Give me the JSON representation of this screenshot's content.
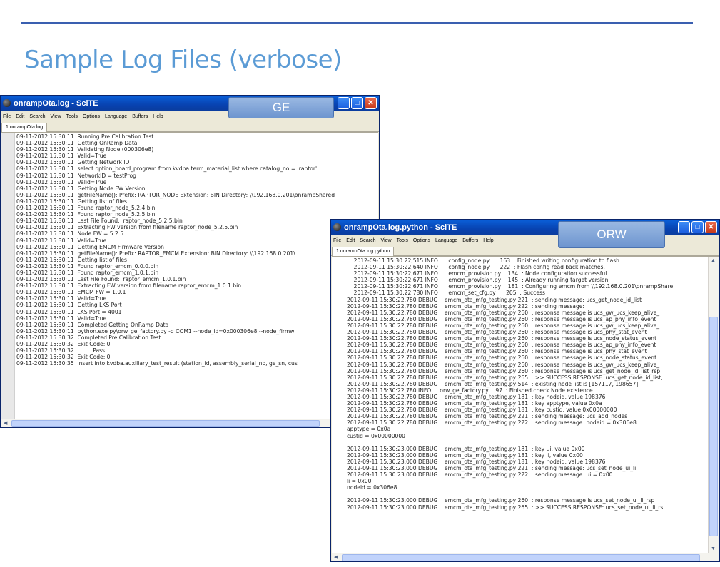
{
  "slide": {
    "title": "Sample Log Files (verbose)"
  },
  "colors": {
    "rule": "#3a5fb0",
    "title": "#5b9bd5",
    "titlebar": "#0842b0",
    "label": "#7aa0d8"
  },
  "menu_items": [
    "File",
    "Edit",
    "Search",
    "View",
    "Tools",
    "Options",
    "Language",
    "Buffers",
    "Help"
  ],
  "ge_window": {
    "title": "onrampOta.log - SciTE",
    "tab": "1 onrampOta.log",
    "label": "GE",
    "lines": [
      "09-11-2012 15:30:11  Running Pre Calibration Test",
      "09-11-2012 15:30:11  Getting OnRamp Data",
      "09-11-2012 15:30:11  Validating Node (000306e8)",
      "09-11-2012 15:30:11  Valid=True",
      "09-11-2012 15:30:11  Getting Network ID",
      "09-11-2012 15:30:11  select option_board_program from kvdba.term_material_list where catalog_no = 'raptor'",
      "09-11-2012 15:30:11  NetworkID = testProg",
      "09-11-2012 15:30:11  Valid=True",
      "09-11-2012 15:30:11  Getting Node FW Version",
      "09-11-2012 15:30:11  getFileName(): Prefix: RAPTOR_NODE Extension: BIN Directory: \\\\192.168.0.201\\onrampShared",
      "09-11-2012 15:30:11  Getting list of files",
      "09-11-2012 15:30:11  Found raptor_node_5.2.4.bin",
      "09-11-2012 15:30:11  Found raptor_node_5.2.5.bin",
      "09-11-2012 15:30:11  Last File Found:  raptor_node_5.2.5.bin",
      "09-11-2012 15:30:11  Extracting FW version from filename raptor_node_5.2.5.bin",
      "09-11-2012 15:30:11  Node FW = 5.2.5",
      "09-11-2012 15:30:11  Valid=True",
      "09-11-2012 15:30:11  Getting EMCM Firmware Version",
      "09-11-2012 15:30:11  getFileName(): Prefix: RAPTOR_EMCM Extension: BIN Directory: \\\\192.168.0.201\\",
      "09-11-2012 15:30:11  Getting list of files",
      "09-11-2012 15:30:11  Found raptor_emcm_0.0.0.bin",
      "09-11-2012 15:30:11  Found raptor_emcm_1.0.1.bin",
      "09-11-2012 15:30:11  Last File Found:  raptor_emcm_1.0.1.bin",
      "09-11-2012 15:30:11  Extracting FW version from filename raptor_emcm_1.0.1.bin",
      "09-11-2012 15:30:11  EMCM FW = 1.0.1",
      "09-11-2012 15:30:11  Valid=True",
      "09-11-2012 15:30:11  Getting LKS Port",
      "09-11-2012 15:30:11  LKS Port = 4001",
      "09-11-2012 15:30:11  Valid=True",
      "09-11-2012 15:30:11  Completed Getting OnRamp Data",
      "09-11-2012 15:30:11  python.exe py\\orw_ge_factory.py -d COM1 --node_id=0x000306e8 --node_firmw",
      "09-11-2012 15:30:32  Completed Pre Calibration Test",
      "09-11-2012 15:30:32  Exit Code: 0",
      "09-11-2012 15:30:32           Pass",
      "09-11-2012 15:30:32  Exit Code: 0",
      "09-11-2012 15:30:35  insert into kvdba.auxiliary_test_result (station_id, assembly_serial_no, ge_sn, cus"
    ]
  },
  "orw_window": {
    "title": "onrampOta.log.python - SciTE",
    "tab": "1 onrampOta.log.python",
    "label": "ORW",
    "lines": [
      "    2012-09-11 15:30:22,515 INFO      config_node.py      163  : Finished writing configuration to flash.",
      "    2012-09-11 15:30:22,640 INFO      config_node.py      222  : Flash config read back matches.",
      "    2012-09-11 15:30:22,671 INFO      emcm_provision.py    134  : Node configuration successful",
      "    2012-09-11 15:30:22,671 INFO      emcm_provision.py    145  : Already running target version",
      "    2012-09-11 15:30:22,671 INFO      emcm_provision.py    181  : Configuring emcm from \\\\192.168.0.201\\onrampShare",
      "    2012-09-11 15:30:22,780 INFO      emcm_set_cfg.py      205  : Success",
      "2012-09-11 15:30:22,780 DEBUG    emcm_ota_mfg_testing.py 221  : sending message: ucs_get_node_id_list",
      "2012-09-11 15:30:22,780 DEBUG    emcm_ota_mfg_testing.py 222  : sending message:",
      "2012-09-11 15:30:22,780 DEBUG    emcm_ota_mfg_testing.py 260  : response message is ucs_gw_ucs_keep_alive_",
      "2012-09-11 15:30:22,780 DEBUG    emcm_ota_mfg_testing.py 260  : response message is ucs_ap_phy_info_event",
      "2012-09-11 15:30:22,780 DEBUG    emcm_ota_mfg_testing.py 260  : response message is ucs_gw_ucs_keep_alive_",
      "2012-09-11 15:30:22,780 DEBUG    emcm_ota_mfg_testing.py 260  : response message is ucs_phy_stat_event",
      "2012-09-11 15:30:22,780 DEBUG    emcm_ota_mfg_testing.py 260  : response message is ucs_node_status_event",
      "2012-09-11 15:30:22,780 DEBUG    emcm_ota_mfg_testing.py 260  : response message is ucs_ap_phy_info_event",
      "2012-09-11 15:30:22,780 DEBUG    emcm_ota_mfg_testing.py 260  : response message is ucs_phy_stat_event",
      "2012-09-11 15:30:22,780 DEBUG    emcm_ota_mfg_testing.py 260  : response message is ucs_node_status_event",
      "2012-09-11 15:30:22,780 DEBUG    emcm_ota_mfg_testing.py 260  : response message is ucs_gw_ucs_keep_alive_",
      "2012-09-11 15:30:22,780 DEBUG    emcm_ota_mfg_testing.py 260  : response message is ucs_get_node_id_list_rsp",
      "2012-09-11 15:30:22,780 DEBUG    emcm_ota_mfg_testing.py 265  : >> SUCCESS RESPONSE: ucs_get_node_id_list,",
      "2012-09-11 15:30:22,780 DEBUG    emcm_ota_mfg_testing.py 514  : existing node list is [157117, 198657]",
      "2012-09-11 15:30:22,780 INFO     orw_ge_factory.py    97  : Finished check Node existence.",
      "2012-09-11 15:30:22,780 DEBUG    emcm_ota_mfg_testing.py 181  : key nodeid, value 198376",
      "2012-09-11 15:30:22,780 DEBUG    emcm_ota_mfg_testing.py 181  : key apptype, value 0x0a",
      "2012-09-11 15:30:22,780 DEBUG    emcm_ota_mfg_testing.py 181  : key custid, value 0x00000000",
      "2012-09-11 15:30:22,780 DEBUG    emcm_ota_mfg_testing.py 221  : sending message: ucs_add_nodes",
      "2012-09-11 15:30:22,780 DEBUG    emcm_ota_mfg_testing.py 222  : sending message: nodeid = 0x306e8",
      "apptype = 0x0a",
      "custid = 0x00000000",
      "",
      "2012-09-11 15:30:23,000 DEBUG    emcm_ota_mfg_testing.py 181  : key ui, value 0x00",
      "2012-09-11 15:30:23,000 DEBUG    emcm_ota_mfg_testing.py 181  : key li, value 0x00",
      "2012-09-11 15:30:23,000 DEBUG    emcm_ota_mfg_testing.py 181  : key nodeid, value 198376",
      "2012-09-11 15:30:23,000 DEBUG    emcm_ota_mfg_testing.py 221  : sending message: ucs_set_node_ui_li",
      "2012-09-11 15:30:23,000 DEBUG    emcm_ota_mfg_testing.py 222  : sending message: ui = 0x00",
      "li = 0x00",
      "nodeid = 0x306e8",
      "",
      "2012-09-11 15:30:23,000 DEBUG    emcm_ota_mfg_testing.py 260  : response message is ucs_set_node_ui_li_rsp",
      "2012-09-11 15:30:23,000 DEBUG    emcm_ota_mfg_testing.py 265  : >> SUCCESS RESPONSE: ucs_set_node_ui_li_rs"
    ]
  }
}
